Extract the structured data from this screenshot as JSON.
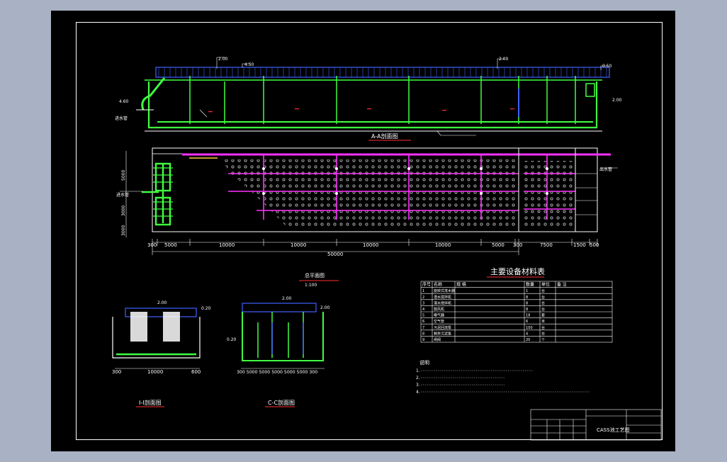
{
  "section_aa": {
    "label": "A-A剖面图"
  },
  "section_11": {
    "label": "I-I剖面图"
  },
  "section_cc": {
    "label": "C-C剖面图"
  },
  "plan": {
    "label": "总平面图",
    "scale": "1:100"
  },
  "dims": {
    "plan_bottom": [
      "300",
      "5000",
      "10000",
      "10000",
      "10000",
      "10000",
      "5000",
      "300",
      "7500",
      "1500",
      "500"
    ],
    "plan_total": "50000",
    "side_left": [
      "5000",
      "3000",
      "3000"
    ],
    "sec11": [
      "300",
      "10000",
      "600"
    ],
    "seccc": "300 5000 5000 5000 5000 5000 300"
  },
  "elev": [
    "2.00",
    "2.00",
    "4.50",
    "0.50",
    "4.60",
    "2.00",
    "2.00",
    "0.20",
    "2.00",
    "2.00",
    "0.20"
  ],
  "labels": {
    "inlet": "进水管",
    "outlet": "出水管"
  },
  "equipment_table": {
    "title": "主要设备材料表",
    "headers": [
      "序号",
      "名称",
      "规 格",
      "数量",
      "单位",
      "备 注"
    ],
    "rows": [
      [
        "1",
        "旋转式滗水器",
        "",
        "1",
        "台",
        ""
      ],
      [
        "2",
        "潜水搅拌机",
        "",
        "8",
        "台",
        ""
      ],
      [
        "3",
        "潜水搅拌机",
        "",
        "8",
        "台",
        ""
      ],
      [
        "4",
        "鼓风机",
        "",
        "8",
        "台",
        ""
      ],
      [
        "5",
        "曝气器",
        "",
        "18",
        "套",
        ""
      ],
      [
        "6",
        "空气管",
        "",
        "6",
        "米",
        ""
      ],
      [
        "7",
        "污泥回流泵",
        "",
        "100",
        "台",
        ""
      ],
      [
        "8",
        "剩余污泥泵",
        "",
        "4",
        "台",
        ""
      ],
      [
        "9",
        "闸阀",
        "",
        "20",
        "个",
        ""
      ]
    ]
  },
  "notes": {
    "title": "说明",
    "lines": [
      "1.",
      "2.",
      "3.",
      "4."
    ]
  },
  "title_block": {
    "drawing_name": "CASS池工艺图"
  },
  "colors": {
    "frame_outer": "#ffffff",
    "frame_inner": "#20c0c0",
    "pipe_green": "#40ff40",
    "pipe_blue": "#4060ff",
    "diffuser_magenta": "#ff30ff",
    "label_red": "#ff3030"
  }
}
